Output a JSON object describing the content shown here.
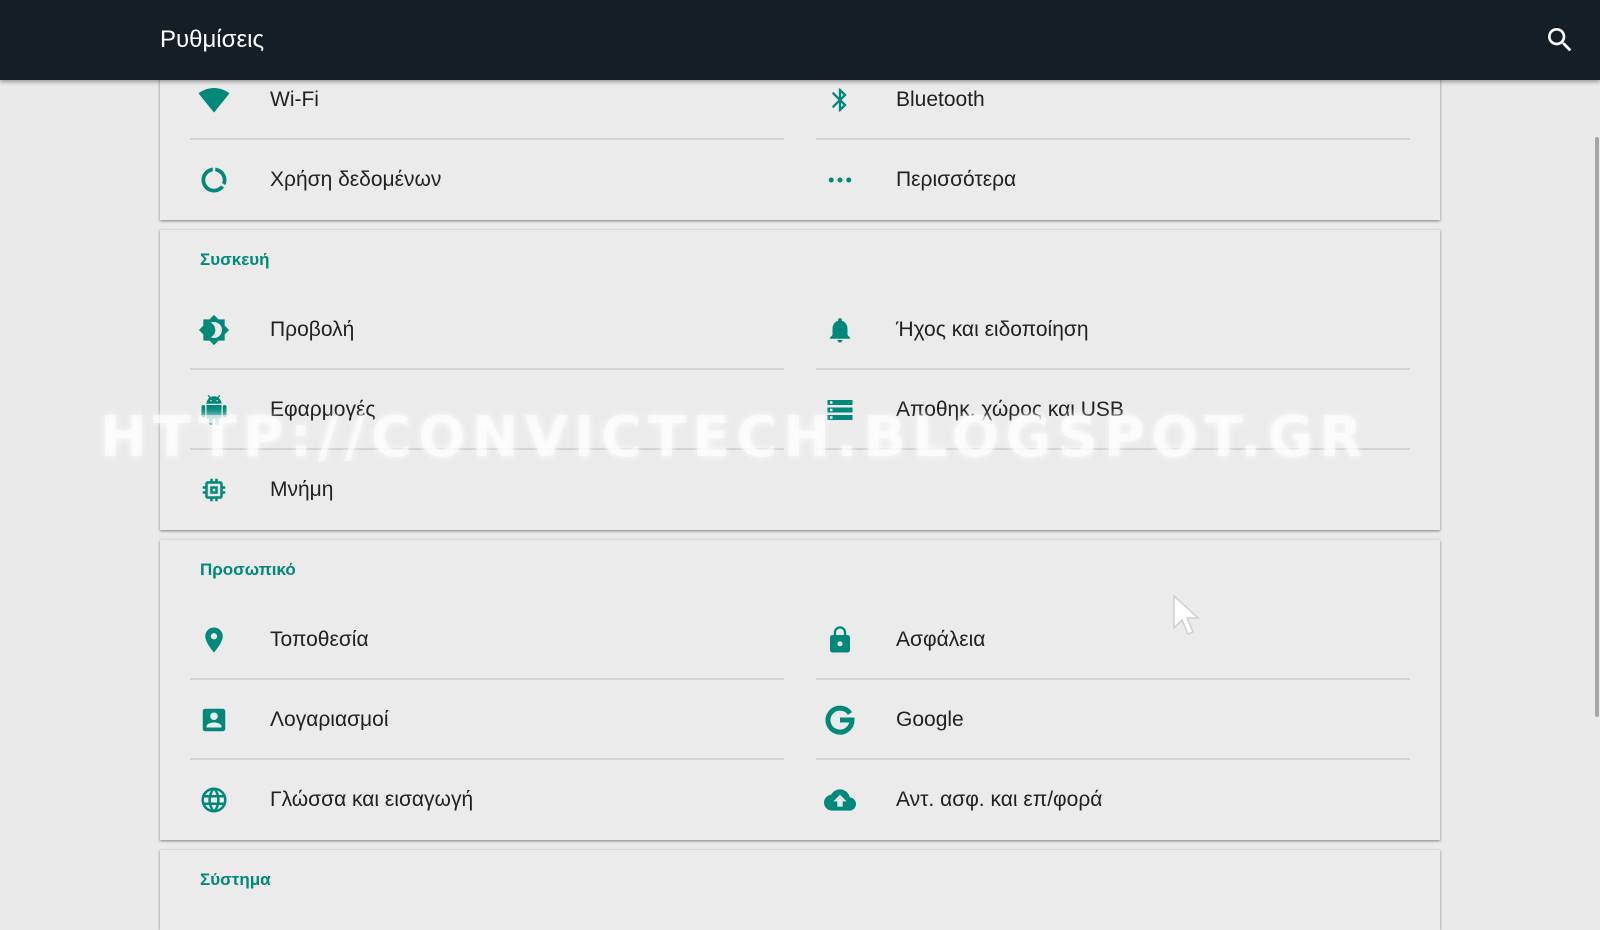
{
  "appbar": {
    "title": "Ρυθμίσεις",
    "search_icon": "search-icon"
  },
  "colors": {
    "accent": "#00897b",
    "appbar": "#141e26",
    "background": "#eaeaea"
  },
  "sections": [
    {
      "header": "",
      "items": [
        {
          "label": "Wi-Fi",
          "icon": "wifi-icon"
        },
        {
          "label": "Bluetooth",
          "icon": "bluetooth-icon"
        },
        {
          "label": "Χρήση δεδομένων",
          "icon": "data-usage-icon"
        },
        {
          "label": "Περισσότερα",
          "icon": "more-horiz-icon"
        }
      ]
    },
    {
      "header": "Συσκευή",
      "items": [
        {
          "label": "Προβολή",
          "icon": "brightness-icon"
        },
        {
          "label": "Ήχος και ειδοποίηση",
          "icon": "bell-icon"
        },
        {
          "label": "Εφαρμογές",
          "icon": "android-icon"
        },
        {
          "label": "Αποθηκ. χώρος και USB",
          "icon": "storage-icon"
        },
        {
          "label": "Μνήμη",
          "icon": "memory-icon"
        }
      ]
    },
    {
      "header": "Προσωπικό",
      "items": [
        {
          "label": "Τοποθεσία",
          "icon": "location-pin-icon"
        },
        {
          "label": "Ασφάλεια",
          "icon": "lock-icon"
        },
        {
          "label": "Λογαριασμοί",
          "icon": "account-box-icon"
        },
        {
          "label": "Google",
          "icon": "google-icon"
        },
        {
          "label": "Γλώσσα και εισαγωγή",
          "icon": "globe-icon"
        },
        {
          "label": "Αντ. ασφ. και επ/φορά",
          "icon": "cloud-upload-icon"
        }
      ]
    },
    {
      "header": "Σύστημα",
      "items": []
    }
  ],
  "watermark": "HTTP://CONVICTECH.BLOGSPOT.GR"
}
